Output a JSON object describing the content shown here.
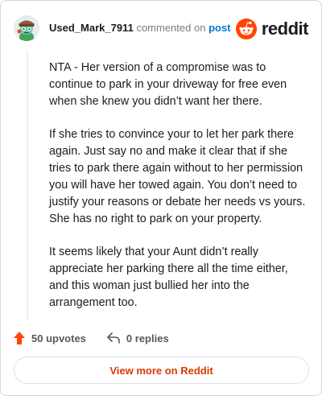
{
  "header": {
    "author": "Used_Mark_7911",
    "commented_on": "commented on",
    "post_link": "post",
    "brand_name": "reddit"
  },
  "comment": {
    "paragraphs": [
      "NTA - Her version of a compromise was to continue to park in your driveway for free even when she knew you didn’t want her there.",
      "If she tries to convince your to let her park there again. Just say no and make it clear that if she tries to park there again without to her permission you will have her towed again. You don’t need to justify your reasons or debate her needs vs yours. She has no right to park on your property.",
      "It seems likely that your Aunt didn’t really appreciate her parking there all the time either, and this woman just bullied her into the arrangement too."
    ]
  },
  "footer": {
    "upvotes_label": "50 upvotes",
    "replies_label": "0 replies",
    "view_more_label": "View more on Reddit"
  },
  "colors": {
    "brand": "#ff4500",
    "link": "#0079d3",
    "view_more": "#d93a00"
  }
}
